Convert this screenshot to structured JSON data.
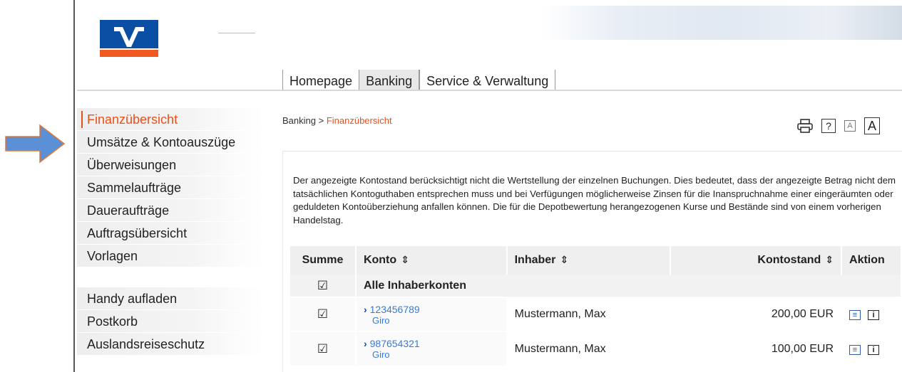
{
  "header": {
    "tabs": [
      {
        "label": "Homepage",
        "active": false
      },
      {
        "label": "Banking",
        "active": true
      },
      {
        "label": "Service & Verwaltung",
        "active": false
      }
    ],
    "logo_icon": "volksbank-logo",
    "brand_colors": {
      "blue": "#0a4fa3",
      "orange": "#f05a22"
    }
  },
  "sidebar": {
    "items": [
      {
        "label": "Finanzübersicht",
        "active": true
      },
      {
        "label": "Umsätze & Kontoauszüge",
        "active": false
      },
      {
        "label": "Überweisungen",
        "active": false
      },
      {
        "label": "Sammelaufträge",
        "active": false
      },
      {
        "label": "Daueraufträge",
        "active": false
      },
      {
        "label": "Auftragsübersicht",
        "active": false
      },
      {
        "label": "Vorlagen",
        "active": false
      }
    ],
    "secondary_items": [
      {
        "label": "Handy aufladen"
      },
      {
        "label": "Postkorb"
      },
      {
        "label": "Auslandsreiseschutz"
      }
    ]
  },
  "breadcrumb": {
    "root": "Banking",
    "separator": ">",
    "current": "Finanzübersicht",
    "current_color": "#e8501a"
  },
  "tools": {
    "print_icon": "printer-icon",
    "help_label": "?",
    "font_small_label": "A",
    "font_large_label": "A"
  },
  "notice": {
    "text": "Der angezeigte Kontostand berücksichtigt nicht die Wertstellung der einzelnen Buchungen. Dies bedeutet, dass der angezeigte Betrag nicht dem tatsächlichen Kontoguthaben entsprechen muss und bei Verfügungen möglicherweise Zinsen für die Inanspruchnahme einer eingeräumten oder geduldeten Kontoüberziehung anfallen können. Die für die Depotbewertung herangezogenen Kurse und Bestände sind von einem vorherigen Handelstag."
  },
  "table": {
    "headers": {
      "summe": "Summe",
      "konto": "Konto",
      "inhaber": "Inhaber",
      "kontostand": "Kontostand",
      "aktion": "Aktion"
    },
    "group_row": {
      "checked": true,
      "label": "Alle Inhaberkonten"
    },
    "rows": [
      {
        "checked": true,
        "account_number": "123456789",
        "account_type": "Giro",
        "owner": "Mustermann, Max",
        "balance": "200,00 EUR"
      },
      {
        "checked": true,
        "account_number": "987654321",
        "account_type": "Giro",
        "owner": "Mustermann, Max",
        "balance": "100,00 EUR"
      }
    ],
    "check_glyph": "☑",
    "sort_glyph": "⇕",
    "chevron_glyph": "›",
    "info_glyph": "i",
    "note_glyph": "≡"
  },
  "highlight_arrow_color": "#5b8fd6"
}
